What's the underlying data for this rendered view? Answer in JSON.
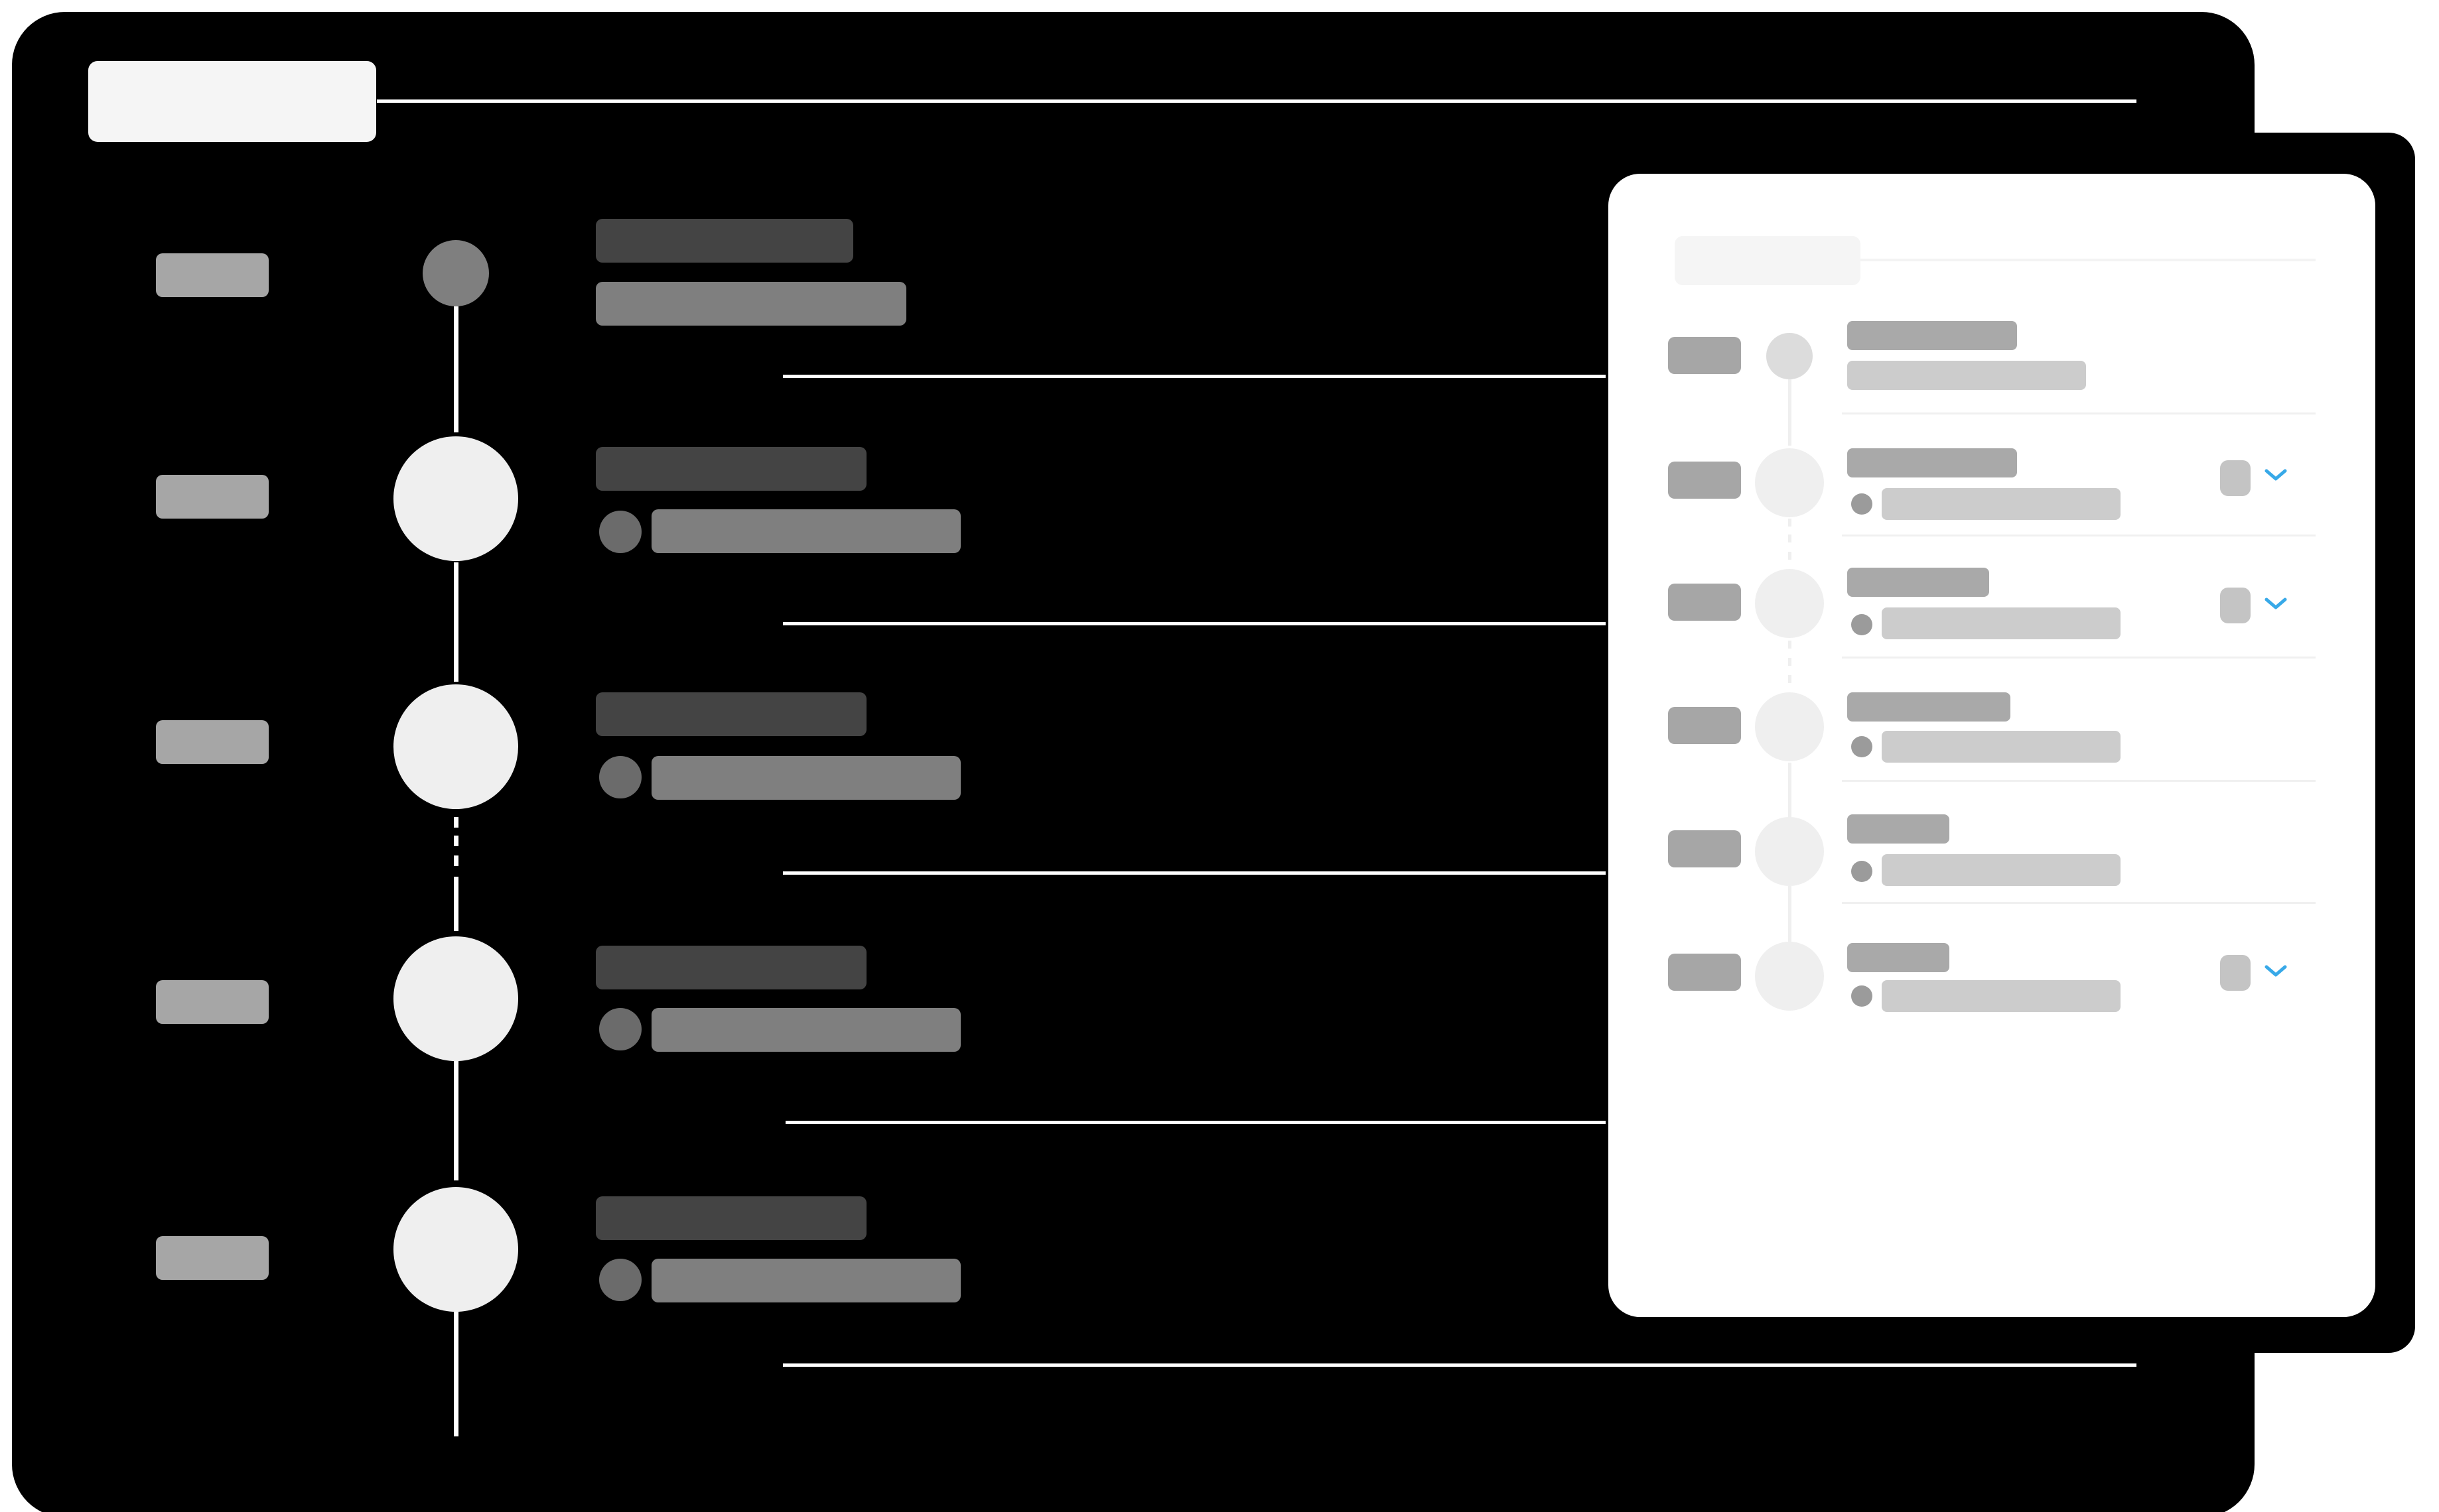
{
  "title": "",
  "colors": {
    "background": "#ffffff",
    "back_panel": "#000000",
    "header_pill": "#f5f5f5",
    "divider": "#ffffff",
    "date_pill": "#a6a6a6",
    "node_small": "#7f7f7f",
    "node_large": "#efefef",
    "title_bar": "#444444",
    "detail_bar": "#7f7f7f",
    "avatar_dot": "#6b6b6b",
    "card": "#ffffff",
    "card_header": "#f5f5f5",
    "card_divider": "#efefef",
    "card_date": "#a6a6a6",
    "card_node_first": "#dcdcdc",
    "card_node": "#efefef",
    "card_title": "#a9a9a9",
    "card_sub": "#cccccc",
    "card_dot": "#9b9b9b",
    "card_badge": "#c4c4c4",
    "chevron": "#38a9e8"
  },
  "icons": {
    "expand": "chevron-down-icon"
  },
  "back_panel": {
    "header_label": "",
    "rows": [
      {
        "date": "",
        "title": "",
        "detail": "",
        "node": "small",
        "has_avatar": false
      },
      {
        "date": "",
        "title": "",
        "detail": "",
        "node": "large",
        "has_avatar": true
      },
      {
        "date": "",
        "title": "",
        "detail": "",
        "node": "large",
        "has_avatar": true
      },
      {
        "date": "",
        "title": "",
        "detail": "",
        "node": "large",
        "has_avatar": true
      },
      {
        "date": "",
        "title": "",
        "detail": "",
        "node": "large",
        "has_avatar": true
      }
    ]
  },
  "card": {
    "header_label": "",
    "rows": [
      {
        "date": "",
        "title": "",
        "subtitle": "",
        "has_dot": false,
        "has_badge": false,
        "has_chevron": false
      },
      {
        "date": "",
        "title": "",
        "subtitle": "",
        "has_dot": true,
        "has_badge": true,
        "has_chevron": true
      },
      {
        "date": "",
        "title": "",
        "subtitle": "",
        "has_dot": true,
        "has_badge": true,
        "has_chevron": true
      },
      {
        "date": "",
        "title": "",
        "subtitle": "",
        "has_dot": true,
        "has_badge": false,
        "has_chevron": false
      },
      {
        "date": "",
        "title": "",
        "subtitle": "",
        "has_dot": true,
        "has_badge": false,
        "has_chevron": false
      },
      {
        "date": "",
        "title": "",
        "subtitle": "",
        "has_dot": true,
        "has_badge": true,
        "has_chevron": true
      }
    ]
  }
}
